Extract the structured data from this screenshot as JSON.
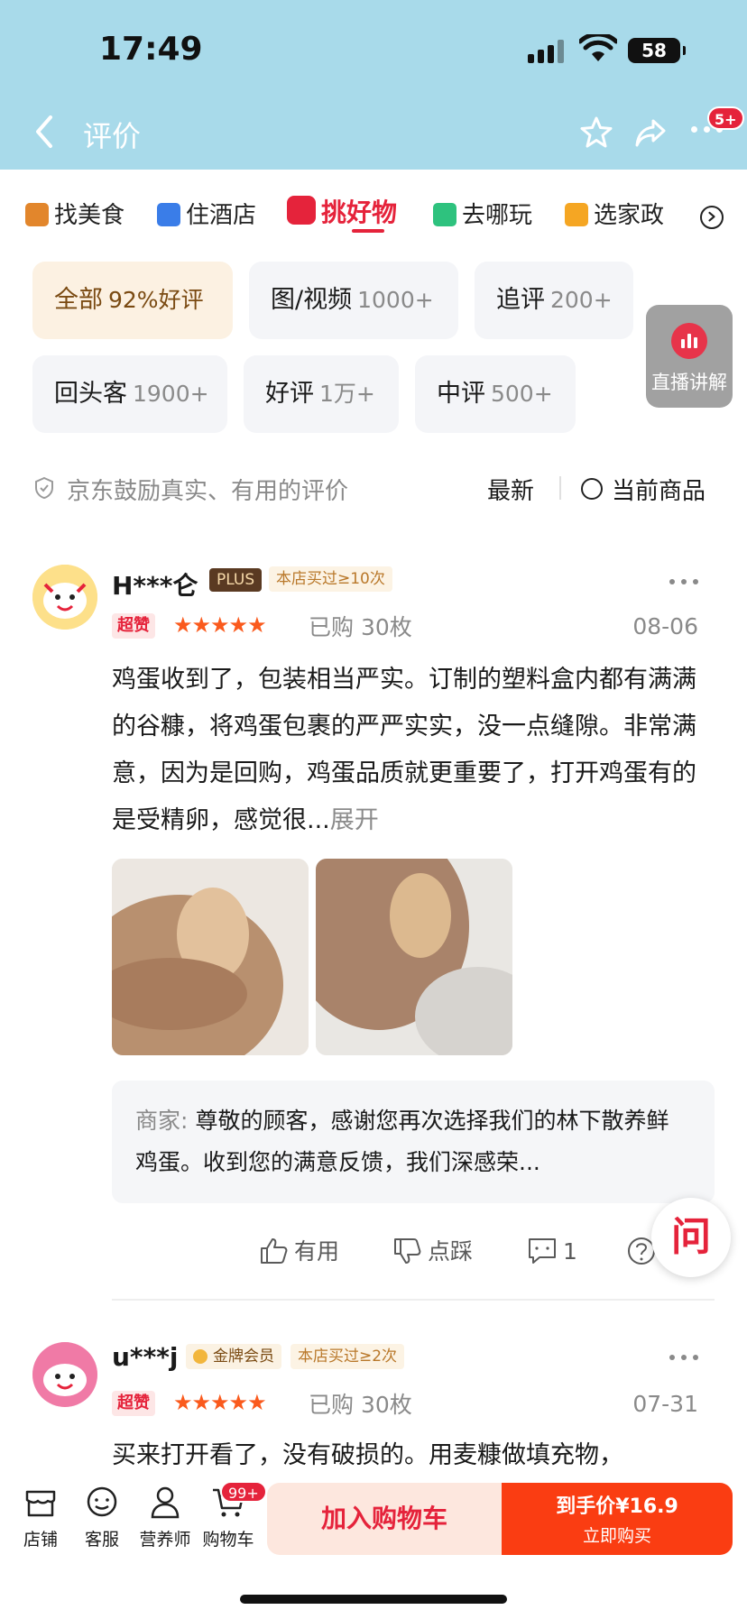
{
  "status": {
    "time": "17:49",
    "battery": "58"
  },
  "nav": {
    "title": "评价",
    "badge": "5+"
  },
  "categories": [
    {
      "label": "找美食",
      "color": "#e2862c"
    },
    {
      "label": "住酒店",
      "color": "#3a7de8"
    },
    {
      "label": "挑好物",
      "color": "#e5233b"
    },
    {
      "label": "去哪玩",
      "color": "#2ec27e"
    },
    {
      "label": "选家政",
      "color": "#f5a623"
    }
  ],
  "filters": [
    {
      "label": "全部",
      "count": "92%好评"
    },
    {
      "label": "图/视频",
      "count": "1000+"
    },
    {
      "label": "追评",
      "count": "200+"
    },
    {
      "label": "回头客",
      "count": "1900+"
    },
    {
      "label": "好评",
      "count": "1万+"
    },
    {
      "label": "中评",
      "count": "500+"
    }
  ],
  "live": {
    "label": "直播讲解"
  },
  "filter_row": {
    "notice": "京东鼓励真实、有用的评价",
    "sort": "最新",
    "current": "当前商品"
  },
  "reviews": [
    {
      "user": "H***仑",
      "plus": "PLUS",
      "repeat": "本店买过≥10次",
      "super": "超赞",
      "stars": "★★★★★",
      "bought": "已购 30枚",
      "date": "08-06",
      "text": "鸡蛋收到了，包装相当严实。订制的塑料盒内都有满满的谷糠，将鸡蛋包裹的严严实实，没一点缝隙。非常满意，因为是回购，鸡蛋品质就更重要了，打开鸡蛋有的是受精卵，感觉很...",
      "more": "展开",
      "reply_label": "商家:",
      "reply": "尊敬的顾客，感谢您再次选择我们的林下散养鲜鸡蛋。收到您的满意反馈，我们深感荣...",
      "useful": "有用",
      "dislike": "点踩",
      "comments": "1"
    },
    {
      "user": "u***j",
      "member": "金牌会员",
      "repeat": "本店买过≥2次",
      "super": "超赞",
      "stars": "★★★★★",
      "bought": "已购 30枚",
      "date": "07-31",
      "text": "买来打开看了，没有破损的。用麦糠做填充物，"
    }
  ],
  "ask": "问",
  "bottom": {
    "store": "店铺",
    "service": "客服",
    "nutrition": "营养师",
    "cart": "购物车",
    "cart_badge": "99+",
    "add_cart": "加入购物车",
    "price": "到手价¥16.9",
    "buy": "立即购买"
  },
  "colors": {
    "accent": "#e5233b",
    "buy": "#fa3d12",
    "header": "#a8daea"
  }
}
